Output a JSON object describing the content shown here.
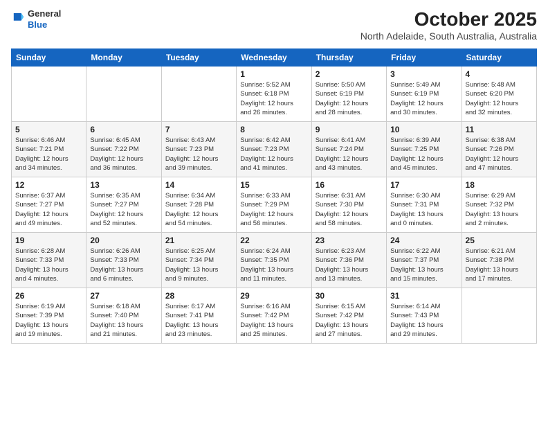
{
  "logo": {
    "general": "General",
    "blue": "Blue"
  },
  "header": {
    "title": "October 2025",
    "subtitle": "North Adelaide, South Australia, Australia"
  },
  "days_of_week": [
    "Sunday",
    "Monday",
    "Tuesday",
    "Wednesday",
    "Thursday",
    "Friday",
    "Saturday"
  ],
  "weeks": [
    [
      {
        "day": "",
        "info": ""
      },
      {
        "day": "",
        "info": ""
      },
      {
        "day": "",
        "info": ""
      },
      {
        "day": "1",
        "info": "Sunrise: 5:52 AM\nSunset: 6:18 PM\nDaylight: 12 hours\nand 26 minutes."
      },
      {
        "day": "2",
        "info": "Sunrise: 5:50 AM\nSunset: 6:19 PM\nDaylight: 12 hours\nand 28 minutes."
      },
      {
        "day": "3",
        "info": "Sunrise: 5:49 AM\nSunset: 6:19 PM\nDaylight: 12 hours\nand 30 minutes."
      },
      {
        "day": "4",
        "info": "Sunrise: 5:48 AM\nSunset: 6:20 PM\nDaylight: 12 hours\nand 32 minutes."
      }
    ],
    [
      {
        "day": "5",
        "info": "Sunrise: 6:46 AM\nSunset: 7:21 PM\nDaylight: 12 hours\nand 34 minutes."
      },
      {
        "day": "6",
        "info": "Sunrise: 6:45 AM\nSunset: 7:22 PM\nDaylight: 12 hours\nand 36 minutes."
      },
      {
        "day": "7",
        "info": "Sunrise: 6:43 AM\nSunset: 7:23 PM\nDaylight: 12 hours\nand 39 minutes."
      },
      {
        "day": "8",
        "info": "Sunrise: 6:42 AM\nSunset: 7:23 PM\nDaylight: 12 hours\nand 41 minutes."
      },
      {
        "day": "9",
        "info": "Sunrise: 6:41 AM\nSunset: 7:24 PM\nDaylight: 12 hours\nand 43 minutes."
      },
      {
        "day": "10",
        "info": "Sunrise: 6:39 AM\nSunset: 7:25 PM\nDaylight: 12 hours\nand 45 minutes."
      },
      {
        "day": "11",
        "info": "Sunrise: 6:38 AM\nSunset: 7:26 PM\nDaylight: 12 hours\nand 47 minutes."
      }
    ],
    [
      {
        "day": "12",
        "info": "Sunrise: 6:37 AM\nSunset: 7:27 PM\nDaylight: 12 hours\nand 49 minutes."
      },
      {
        "day": "13",
        "info": "Sunrise: 6:35 AM\nSunset: 7:27 PM\nDaylight: 12 hours\nand 52 minutes."
      },
      {
        "day": "14",
        "info": "Sunrise: 6:34 AM\nSunset: 7:28 PM\nDaylight: 12 hours\nand 54 minutes."
      },
      {
        "day": "15",
        "info": "Sunrise: 6:33 AM\nSunset: 7:29 PM\nDaylight: 12 hours\nand 56 minutes."
      },
      {
        "day": "16",
        "info": "Sunrise: 6:31 AM\nSunset: 7:30 PM\nDaylight: 12 hours\nand 58 minutes."
      },
      {
        "day": "17",
        "info": "Sunrise: 6:30 AM\nSunset: 7:31 PM\nDaylight: 13 hours\nand 0 minutes."
      },
      {
        "day": "18",
        "info": "Sunrise: 6:29 AM\nSunset: 7:32 PM\nDaylight: 13 hours\nand 2 minutes."
      }
    ],
    [
      {
        "day": "19",
        "info": "Sunrise: 6:28 AM\nSunset: 7:33 PM\nDaylight: 13 hours\nand 4 minutes."
      },
      {
        "day": "20",
        "info": "Sunrise: 6:26 AM\nSunset: 7:33 PM\nDaylight: 13 hours\nand 6 minutes."
      },
      {
        "day": "21",
        "info": "Sunrise: 6:25 AM\nSunset: 7:34 PM\nDaylight: 13 hours\nand 9 minutes."
      },
      {
        "day": "22",
        "info": "Sunrise: 6:24 AM\nSunset: 7:35 PM\nDaylight: 13 hours\nand 11 minutes."
      },
      {
        "day": "23",
        "info": "Sunrise: 6:23 AM\nSunset: 7:36 PM\nDaylight: 13 hours\nand 13 minutes."
      },
      {
        "day": "24",
        "info": "Sunrise: 6:22 AM\nSunset: 7:37 PM\nDaylight: 13 hours\nand 15 minutes."
      },
      {
        "day": "25",
        "info": "Sunrise: 6:21 AM\nSunset: 7:38 PM\nDaylight: 13 hours\nand 17 minutes."
      }
    ],
    [
      {
        "day": "26",
        "info": "Sunrise: 6:19 AM\nSunset: 7:39 PM\nDaylight: 13 hours\nand 19 minutes."
      },
      {
        "day": "27",
        "info": "Sunrise: 6:18 AM\nSunset: 7:40 PM\nDaylight: 13 hours\nand 21 minutes."
      },
      {
        "day": "28",
        "info": "Sunrise: 6:17 AM\nSunset: 7:41 PM\nDaylight: 13 hours\nand 23 minutes."
      },
      {
        "day": "29",
        "info": "Sunrise: 6:16 AM\nSunset: 7:42 PM\nDaylight: 13 hours\nand 25 minutes."
      },
      {
        "day": "30",
        "info": "Sunrise: 6:15 AM\nSunset: 7:42 PM\nDaylight: 13 hours\nand 27 minutes."
      },
      {
        "day": "31",
        "info": "Sunrise: 6:14 AM\nSunset: 7:43 PM\nDaylight: 13 hours\nand 29 minutes."
      },
      {
        "day": "",
        "info": ""
      }
    ]
  ]
}
